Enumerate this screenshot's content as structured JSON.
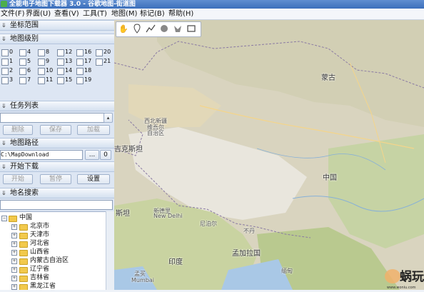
{
  "app": {
    "title": "全能电子地图下载器 3.0 - 谷歌地图-街道图"
  },
  "menu": [
    "文件(F)",
    "界面(U)",
    "查看(V)",
    "工具(T)",
    "地图(M)",
    "标记(B)",
    "帮助(H)"
  ],
  "sections": {
    "coords": {
      "chev": "⇓",
      "label": "坐标范围"
    },
    "levels": {
      "chev": "⇓",
      "label": "地图级别",
      "items": [
        "0",
        "1",
        "2",
        "3",
        "4",
        "5",
        "6",
        "7",
        "8",
        "9",
        "10",
        "11",
        "12",
        "13",
        "14",
        "15",
        "16",
        "17",
        "18",
        "19",
        "20",
        "21"
      ]
    },
    "tasks": {
      "chev": "⇓",
      "label": "任务列表",
      "buttons": {
        "delete": "删除",
        "save": "保存",
        "load": "加载"
      }
    },
    "path": {
      "chev": "⇓",
      "label": "地图路径",
      "value": "C:\\MapDownload",
      "browse": "...",
      "zero": "0"
    },
    "download": {
      "chev": "⇓",
      "label": "开始下载",
      "buttons": {
        "start": "开始",
        "pause": "暂停",
        "settings": "设置"
      }
    },
    "search": {
      "chev": "⇓",
      "label": "地名搜索"
    }
  },
  "tree": {
    "root": "中国",
    "children": [
      "北京市",
      "天津市",
      "河北省",
      "山西省",
      "内蒙古自治区",
      "辽宁省",
      "吉林省",
      "黑龙江省"
    ]
  },
  "map": {
    "labels": {
      "mongolia": "蒙古",
      "xinjiang_1": "西北新疆",
      "xinjiang_2": "维吾尔",
      "xinjiang_3": "自治区",
      "kazakhstan": "吉克斯坦",
      "china": "中国",
      "pakistan": "斯坦",
      "delhi_zh": "新德里",
      "delhi_en": "New Delhi",
      "nepal": "尼泊尔",
      "bhutan": "不丹",
      "bangladesh": "孟加拉国",
      "india": "印度",
      "myanmar": "缅甸",
      "mumbai": "孟买",
      "mumbai_en": "Mumbai"
    },
    "tools": [
      "pan-hand",
      "marker-pin",
      "polyline",
      "circle",
      "polygon",
      "rectangle"
    ]
  },
  "watermark": {
    "text": "蜗玩",
    "sub": "www.woniu.com"
  }
}
